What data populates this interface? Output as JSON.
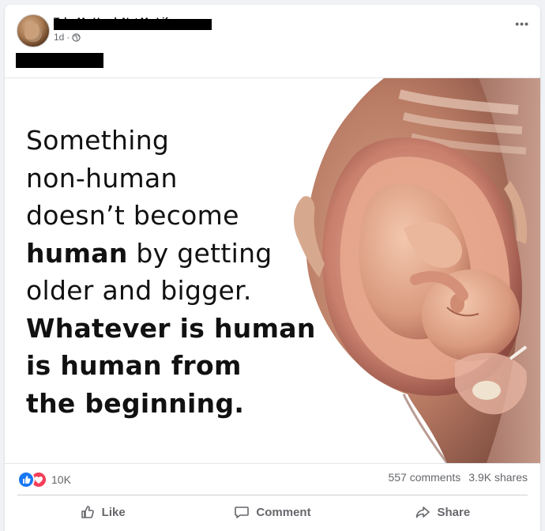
{
  "post": {
    "author_name": "Take My Hand, Not My Life",
    "time": "1d",
    "visibility_separator": "·",
    "more_label": "•••"
  },
  "image_text": {
    "line1": "Something",
    "line2": "non-human",
    "line3": "doesn’t become",
    "line4_bold": "human",
    "line4_rest": " by getting",
    "line5": "older and bigger.",
    "line6": "Whatever is human",
    "line7": "is human from",
    "line8": "the beginning."
  },
  "reactions": {
    "count": "10K",
    "types": [
      "like-icon",
      "love-icon"
    ]
  },
  "stats": {
    "comments": "557 comments",
    "shares": "3.9K shares"
  },
  "actions": {
    "like": "Like",
    "comment": "Comment",
    "share": "Share"
  },
  "colors": {
    "like_blue": "#1877f2",
    "love_red": "#f33e58",
    "secondary_text": "#65676b"
  }
}
